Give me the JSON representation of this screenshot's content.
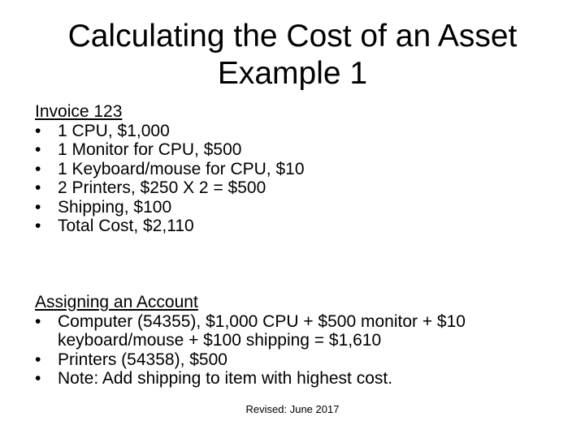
{
  "title": {
    "line1": "Calculating the Cost of an Asset",
    "line2": "Example 1"
  },
  "bullet_glyph": "•",
  "invoice": {
    "heading": "Invoice 123",
    "items": [
      "1 CPU, $1,000",
      "1 Monitor for CPU, $500",
      "1 Keyboard/mouse for CPU, $10",
      "2 Printers, $250 X 2 = $500",
      "Shipping, $100",
      "Total Cost, $2,110"
    ]
  },
  "account": {
    "heading": "Assigning an Account",
    "items": [
      "Computer (54355), $1,000 CPU + $500 monitor + $10 keyboard/mouse + $100 shipping = $1,610",
      "Printers (54358), $500",
      "Note: Add shipping to item with highest cost."
    ]
  },
  "footer": {
    "revised": "Revised: June 2017"
  }
}
